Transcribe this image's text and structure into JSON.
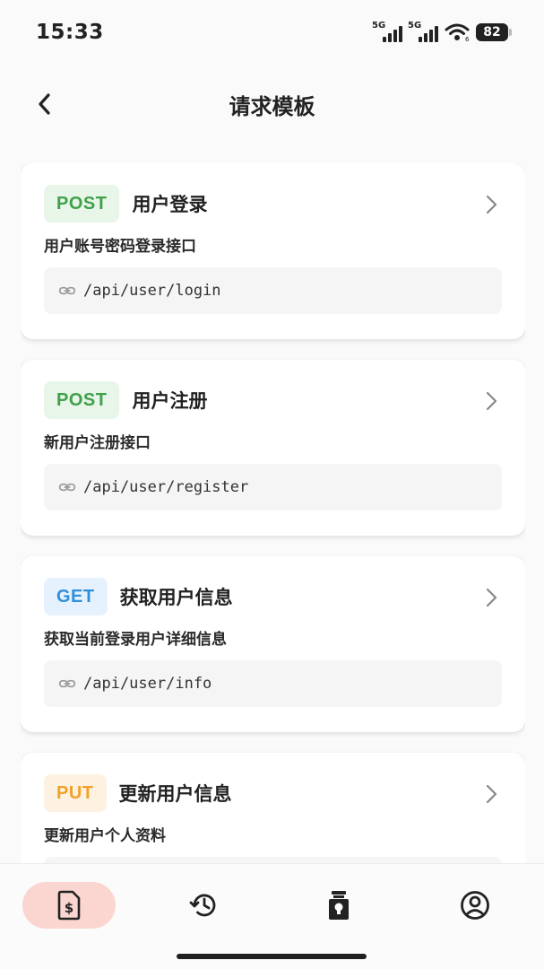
{
  "status_bar": {
    "time": "15:33",
    "signal1_label": "5G",
    "signal2_label": "5G",
    "battery": "82"
  },
  "header": {
    "title": "请求模板",
    "back_icon": "chevron-left-icon"
  },
  "templates": [
    {
      "method": "POST",
      "method_color": "#3fa14a",
      "method_bg": "#e8f5e9",
      "title": "用户登录",
      "description": "用户账号密码登录接口",
      "path": "/api/user/login"
    },
    {
      "method": "POST",
      "method_color": "#3fa14a",
      "method_bg": "#e8f5e9",
      "title": "用户注册",
      "description": "新用户注册接口",
      "path": "/api/user/register"
    },
    {
      "method": "GET",
      "method_color": "#2f8fdb",
      "method_bg": "#e5f1fc",
      "title": "获取用户信息",
      "description": "获取当前登录用户详细信息",
      "path": "/api/user/info"
    },
    {
      "method": "PUT",
      "method_color": "#f2a12a",
      "method_bg": "#fdf1e2",
      "title": "更新用户信息",
      "description": "更新用户个人资料",
      "path": ""
    }
  ],
  "bottom_nav": {
    "items": [
      {
        "icon": "dollar-document-icon",
        "active": true
      },
      {
        "icon": "history-icon",
        "active": false
      },
      {
        "icon": "lightbulb-jar-icon",
        "active": false
      },
      {
        "icon": "user-circle-icon",
        "active": false
      }
    ],
    "active_color": "#fbd6d0"
  }
}
